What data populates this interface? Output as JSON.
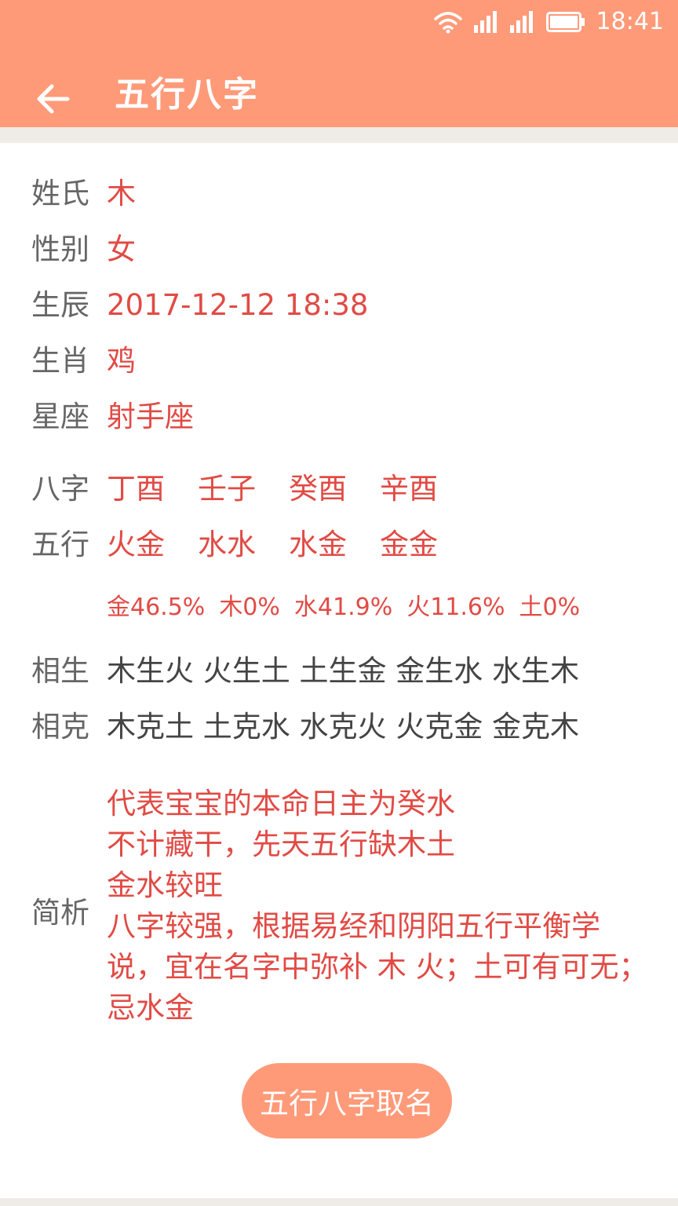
{
  "status_bar": {
    "time": "18:41"
  },
  "app_bar": {
    "title": "五行八字"
  },
  "profile": {
    "surname_label": "姓氏",
    "surname": "木",
    "gender_label": "性别",
    "gender": "女",
    "birth_label": "生辰",
    "birth": "2017-12-12 18:38",
    "zodiac_label": "生肖",
    "zodiac": "鸡",
    "constellation_label": "星座",
    "constellation": "射手座"
  },
  "bazi": {
    "label": "八字",
    "pillars": [
      "丁酉",
      "壬子",
      "癸酉",
      "辛酉"
    ]
  },
  "wuxing": {
    "label": "五行",
    "pillars": [
      "火金",
      "水水",
      "水金",
      "金金"
    ],
    "percentages": [
      "金46.5%",
      "木0%",
      "水41.9%",
      "火11.6%",
      "土0%"
    ]
  },
  "relations": {
    "sheng_label": "相生",
    "sheng": "木生火 火生土 土生金 金生水 水生木",
    "ke_label": "相克",
    "ke": "木克土 土克水 水克火 火克金 金克木"
  },
  "analysis": {
    "label": "简析",
    "lines": [
      "代表宝宝的本命日主为癸水",
      "不计藏干，先天五行缺木土",
      "金水较旺",
      "八字较强，根据易经和阴阳五行平衡学",
      "说，宜在名字中弥补 木 火；土可有可无；",
      "忌水金"
    ]
  },
  "action_button": {
    "label": "五行八字取名"
  },
  "colors": {
    "accent": "#ff9a79",
    "value_red": "#e14b45",
    "label_gray": "#666666"
  },
  "icons": {
    "back": "arrow-left-icon",
    "wifi": "wifi-icon",
    "signal": "signal-icon",
    "battery": "battery-icon"
  }
}
